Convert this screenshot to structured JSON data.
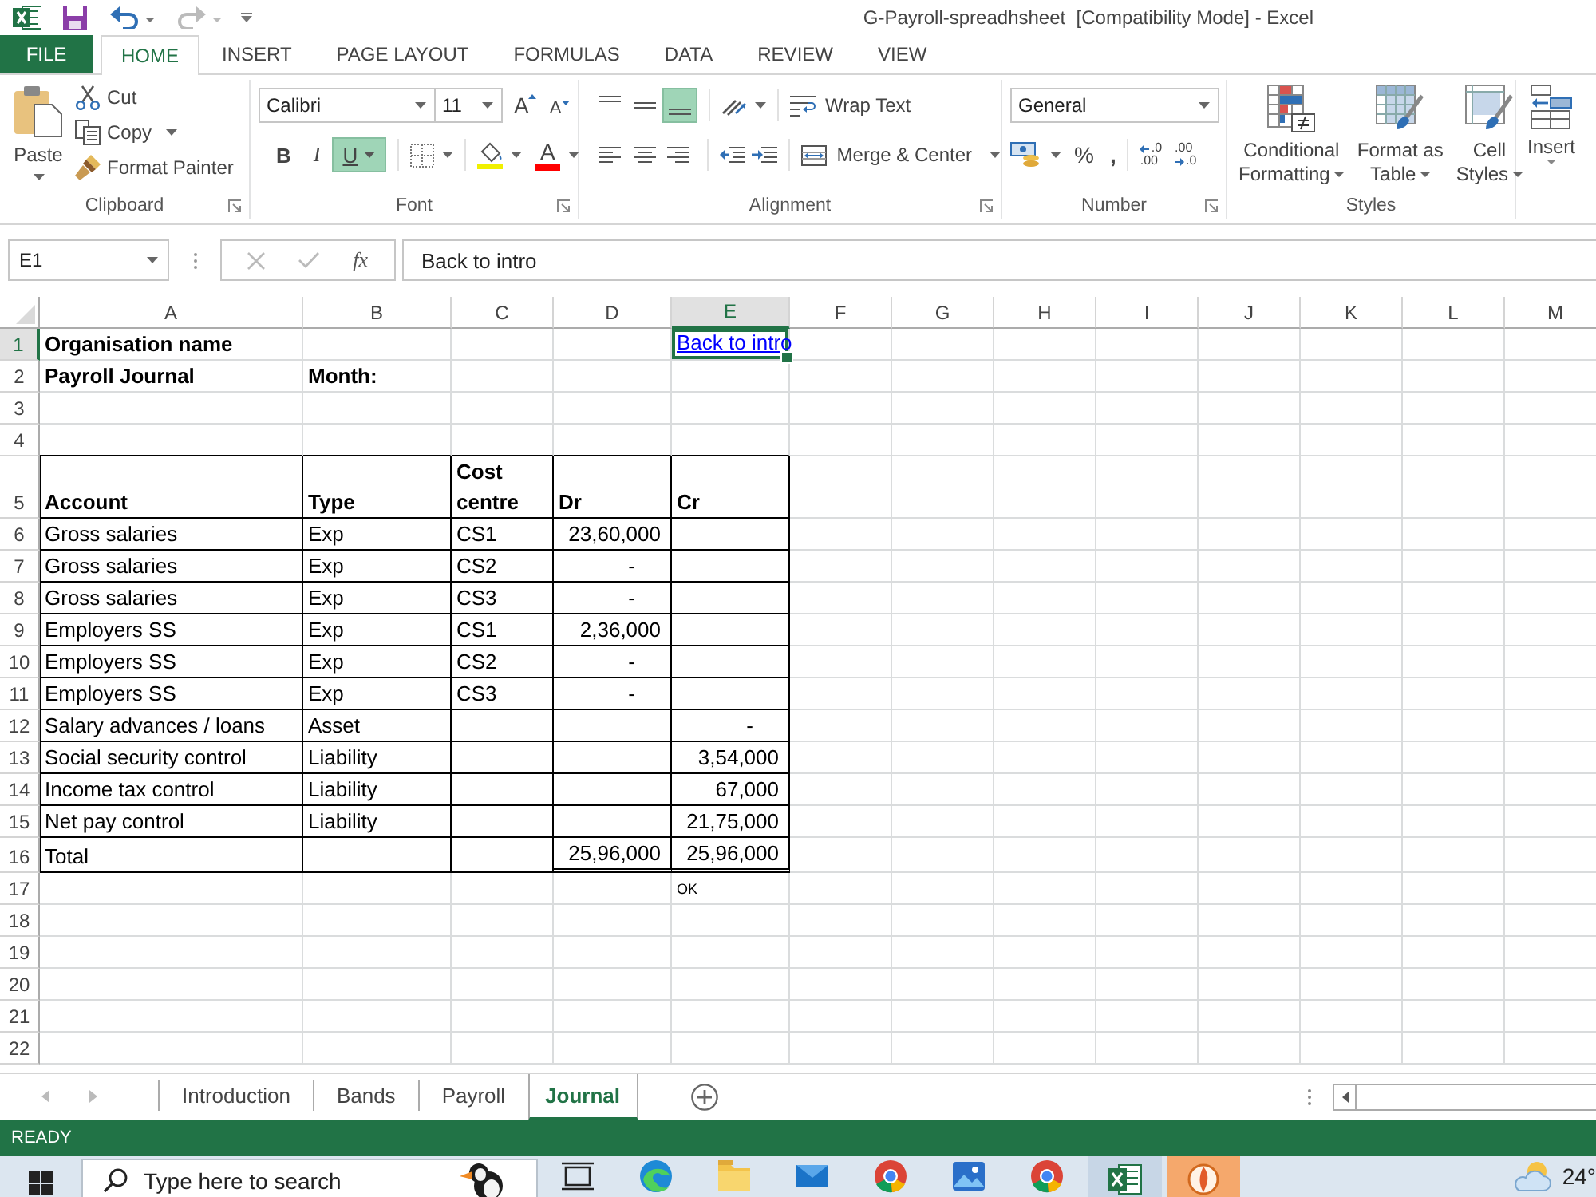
{
  "window": {
    "title": "G-Payroll-spreadhsheet  [Compatibility Mode] - Excel"
  },
  "ribbon": {
    "tabs": [
      {
        "label": "FILE",
        "kind": "file",
        "selected": false
      },
      {
        "label": "HOME",
        "kind": "tab",
        "selected": true
      },
      {
        "label": "INSERT",
        "kind": "tab",
        "selected": false
      },
      {
        "label": "PAGE LAYOUT",
        "kind": "tab",
        "selected": false
      },
      {
        "label": "FORMULAS",
        "kind": "tab",
        "selected": false
      },
      {
        "label": "DATA",
        "kind": "tab",
        "selected": false
      },
      {
        "label": "REVIEW",
        "kind": "tab",
        "selected": false
      },
      {
        "label": "VIEW",
        "kind": "tab",
        "selected": false
      }
    ],
    "clipboard": {
      "label": "Clipboard",
      "paste": "Paste",
      "cut": "Cut",
      "copy": "Copy",
      "format_painter": "Format Painter"
    },
    "font": {
      "label": "Font",
      "name": "Calibri",
      "size": "11",
      "grow": "A",
      "shrink": "A",
      "styles": [
        {
          "kind": "bold",
          "text": "B",
          "on": false
        },
        {
          "kind": "italic",
          "text": "I",
          "on": false
        },
        {
          "kind": "underline",
          "text": "U",
          "on": true
        }
      ],
      "font_color": "A"
    },
    "alignment": {
      "label": "Alignment",
      "vertical": [
        {
          "kind": "top",
          "on": false
        },
        {
          "kind": "middle",
          "on": false
        },
        {
          "kind": "bottom",
          "on": true
        }
      ],
      "horizontal": [
        {
          "kind": "left",
          "on": false
        },
        {
          "kind": "center",
          "on": false
        },
        {
          "kind": "right",
          "on": false
        }
      ],
      "wrap_text": "Wrap Text",
      "merge_center": "Merge & Center"
    },
    "number": {
      "label": "Number",
      "format": "General",
      "percent": "%",
      "comma": ",",
      "decimals": [
        {
          "kind": "increase",
          "top": ".0",
          "bottom": ".00"
        },
        {
          "kind": "decrease",
          "top": ".00",
          "bottom": ".0"
        }
      ]
    },
    "styles": {
      "label": "Styles",
      "buttons": [
        {
          "kind": "conditional",
          "lines": [
            "Conditional",
            "Formatting"
          ]
        },
        {
          "kind": "table",
          "lines": [
            "Format as",
            "Table"
          ]
        },
        {
          "kind": "cell",
          "lines": [
            "Cell",
            "Styles"
          ]
        }
      ]
    },
    "cells": {
      "insert": "Insert"
    }
  },
  "formula_bar": {
    "name_box": "E1",
    "fx": "fx",
    "formula": "Back to intro"
  },
  "sheet": {
    "columns": [
      {
        "label": "A",
        "selected": false
      },
      {
        "label": "B",
        "selected": false
      },
      {
        "label": "C",
        "selected": false
      },
      {
        "label": "D",
        "selected": false
      },
      {
        "label": "E",
        "selected": true
      },
      {
        "label": "F",
        "selected": false
      },
      {
        "label": "G",
        "selected": false
      },
      {
        "label": "H",
        "selected": false
      },
      {
        "label": "I",
        "selected": false
      },
      {
        "label": "J",
        "selected": false
      },
      {
        "label": "K",
        "selected": false
      },
      {
        "label": "L",
        "selected": false
      },
      {
        "label": "M",
        "selected": false
      }
    ],
    "rows": [
      {
        "number": "1",
        "selected": true,
        "kind": "plain",
        "cells": [
          {
            "kind": "text",
            "text": "Organisation name",
            "bold": true
          },
          {
            "kind": "empty"
          },
          {
            "kind": "empty"
          },
          {
            "kind": "empty"
          },
          {
            "kind": "link",
            "text": "Back to intro"
          }
        ]
      },
      {
        "number": "2",
        "selected": false,
        "kind": "plain",
        "cells": [
          {
            "kind": "text",
            "text": "Payroll Journal",
            "bold": true
          },
          {
            "kind": "text",
            "text": "Month:",
            "bold": true
          },
          {
            "kind": "empty"
          },
          {
            "kind": "empty"
          },
          {
            "kind": "empty"
          }
        ]
      },
      {
        "number": "3",
        "selected": false,
        "kind": "plain"
      },
      {
        "number": "4",
        "selected": false,
        "kind": "plain"
      },
      {
        "number": "5",
        "selected": false,
        "kind": "table",
        "cells": [
          {
            "kind": "text",
            "text": "Account",
            "bold": true
          },
          {
            "kind": "text",
            "text": "Type",
            "bold": true
          },
          {
            "kind": "text",
            "text": "Cost centre",
            "bold": true
          },
          {
            "kind": "text",
            "text": "Dr",
            "bold": true
          },
          {
            "kind": "text",
            "text": "Cr",
            "bold": true
          }
        ]
      },
      {
        "number": "6",
        "selected": false,
        "kind": "table",
        "cells": [
          {
            "kind": "text",
            "text": "Gross salaries",
            "bold": false
          },
          {
            "kind": "text",
            "text": "Exp",
            "bold": false
          },
          {
            "kind": "text",
            "text": "CS1",
            "bold": false
          },
          {
            "kind": "number",
            "text": "23,60,000",
            "bold": false
          },
          {
            "kind": "empty"
          }
        ]
      },
      {
        "number": "7",
        "selected": false,
        "kind": "table",
        "cells": [
          {
            "kind": "text",
            "text": "Gross salaries",
            "bold": false
          },
          {
            "kind": "text",
            "text": "Exp",
            "bold": false
          },
          {
            "kind": "text",
            "text": "CS2",
            "bold": false
          },
          {
            "kind": "zero",
            "text": "-",
            "bold": false
          },
          {
            "kind": "empty"
          }
        ]
      },
      {
        "number": "8",
        "selected": false,
        "kind": "table",
        "cells": [
          {
            "kind": "text",
            "text": "Gross salaries",
            "bold": false
          },
          {
            "kind": "text",
            "text": "Exp",
            "bold": false
          },
          {
            "kind": "text",
            "text": "CS3",
            "bold": false
          },
          {
            "kind": "zero",
            "text": "-",
            "bold": false
          },
          {
            "kind": "empty"
          }
        ]
      },
      {
        "number": "9",
        "selected": false,
        "kind": "table",
        "cells": [
          {
            "kind": "text",
            "text": "Employers SS",
            "bold": false
          },
          {
            "kind": "text",
            "text": "Exp",
            "bold": false
          },
          {
            "kind": "text",
            "text": "CS1",
            "bold": false
          },
          {
            "kind": "number",
            "text": "2,36,000",
            "bold": false
          },
          {
            "kind": "empty"
          }
        ]
      },
      {
        "number": "10",
        "selected": false,
        "kind": "table",
        "cells": [
          {
            "kind": "text",
            "text": "Employers SS",
            "bold": false
          },
          {
            "kind": "text",
            "text": "Exp",
            "bold": false
          },
          {
            "kind": "text",
            "text": "CS2",
            "bold": false
          },
          {
            "kind": "zero",
            "text": "-",
            "bold": false
          },
          {
            "kind": "empty"
          }
        ]
      },
      {
        "number": "11",
        "selected": false,
        "kind": "table",
        "cells": [
          {
            "kind": "text",
            "text": "Employers SS",
            "bold": false
          },
          {
            "kind": "text",
            "text": "Exp",
            "bold": false
          },
          {
            "kind": "text",
            "text": "CS3",
            "bold": false
          },
          {
            "kind": "zero",
            "text": "-",
            "bold": false
          },
          {
            "kind": "empty"
          }
        ]
      },
      {
        "number": "12",
        "selected": false,
        "kind": "table",
        "cells": [
          {
            "kind": "text",
            "text": "Salary advances / loans",
            "bold": false
          },
          {
            "kind": "text",
            "text": "Asset",
            "bold": false
          },
          {
            "kind": "empty"
          },
          {
            "kind": "empty"
          },
          {
            "kind": "zero",
            "text": "-",
            "bold": false
          }
        ]
      },
      {
        "number": "13",
        "selected": false,
        "kind": "table",
        "cells": [
          {
            "kind": "text",
            "text": "Social security control",
            "bold": false
          },
          {
            "kind": "text",
            "text": "Liability",
            "bold": false
          },
          {
            "kind": "empty"
          },
          {
            "kind": "empty"
          },
          {
            "kind": "number",
            "text": "3,54,000",
            "bold": false
          }
        ]
      },
      {
        "number": "14",
        "selected": false,
        "kind": "table",
        "cells": [
          {
            "kind": "text",
            "text": "Income tax control",
            "bold": false
          },
          {
            "kind": "text",
            "text": "Liability",
            "bold": false
          },
          {
            "kind": "empty"
          },
          {
            "kind": "empty"
          },
          {
            "kind": "number",
            "text": "67,000",
            "bold": false
          }
        ]
      },
      {
        "number": "15",
        "selected": false,
        "kind": "table",
        "cells": [
          {
            "kind": "text",
            "text": "Net pay control",
            "bold": false
          },
          {
            "kind": "text",
            "text": "Liability",
            "bold": false
          },
          {
            "kind": "empty"
          },
          {
            "kind": "empty"
          },
          {
            "kind": "number",
            "text": "21,75,000",
            "bold": false
          }
        ]
      },
      {
        "number": "16",
        "selected": false,
        "kind": "total",
        "cells": [
          {
            "kind": "text",
            "text": "Total",
            "bold": false
          },
          {
            "kind": "empty"
          },
          {
            "kind": "empty"
          },
          {
            "kind": "number",
            "text": "25,96,000",
            "bold": false
          },
          {
            "kind": "number",
            "text": "25,96,000",
            "bold": false
          }
        ]
      },
      {
        "number": "17",
        "selected": false,
        "kind": "plain",
        "cells": [
          {
            "kind": "empty"
          },
          {
            "kind": "empty"
          },
          {
            "kind": "empty"
          },
          {
            "kind": "empty"
          },
          {
            "kind": "note",
            "text": "OK"
          }
        ]
      },
      {
        "number": "18",
        "selected": false,
        "kind": "plain"
      },
      {
        "number": "19",
        "selected": false,
        "kind": "plain"
      },
      {
        "number": "20",
        "selected": false,
        "kind": "plain"
      },
      {
        "number": "21",
        "selected": false,
        "kind": "plain"
      },
      {
        "number": "22",
        "selected": false,
        "kind": "plain"
      }
    ]
  },
  "sheet_tabs": [
    {
      "label": "Introduction",
      "selected": false
    },
    {
      "label": "Bands",
      "selected": false
    },
    {
      "label": "Payroll",
      "selected": false
    },
    {
      "label": "Journal",
      "selected": true
    }
  ],
  "status_bar": {
    "text": "READY"
  },
  "taskbar": {
    "search": {
      "placeholder": "Type here to search"
    },
    "apps": [
      {
        "kind": "task-view",
        "selected": false,
        "alert": false
      },
      {
        "kind": "wave-browser",
        "selected": false,
        "alert": false
      },
      {
        "kind": "folder",
        "selected": false,
        "alert": false
      },
      {
        "kind": "mail",
        "selected": false,
        "alert": false
      },
      {
        "kind": "ring-browser",
        "selected": false,
        "alert": false
      },
      {
        "kind": "photos",
        "selected": false,
        "alert": false
      },
      {
        "kind": "ring-browser",
        "selected": false,
        "alert": false
      },
      {
        "kind": "spreadsheet",
        "selected": true,
        "alert": false
      },
      {
        "kind": "orange-app",
        "selected": false,
        "alert": true
      }
    ],
    "weather": "24°"
  }
}
